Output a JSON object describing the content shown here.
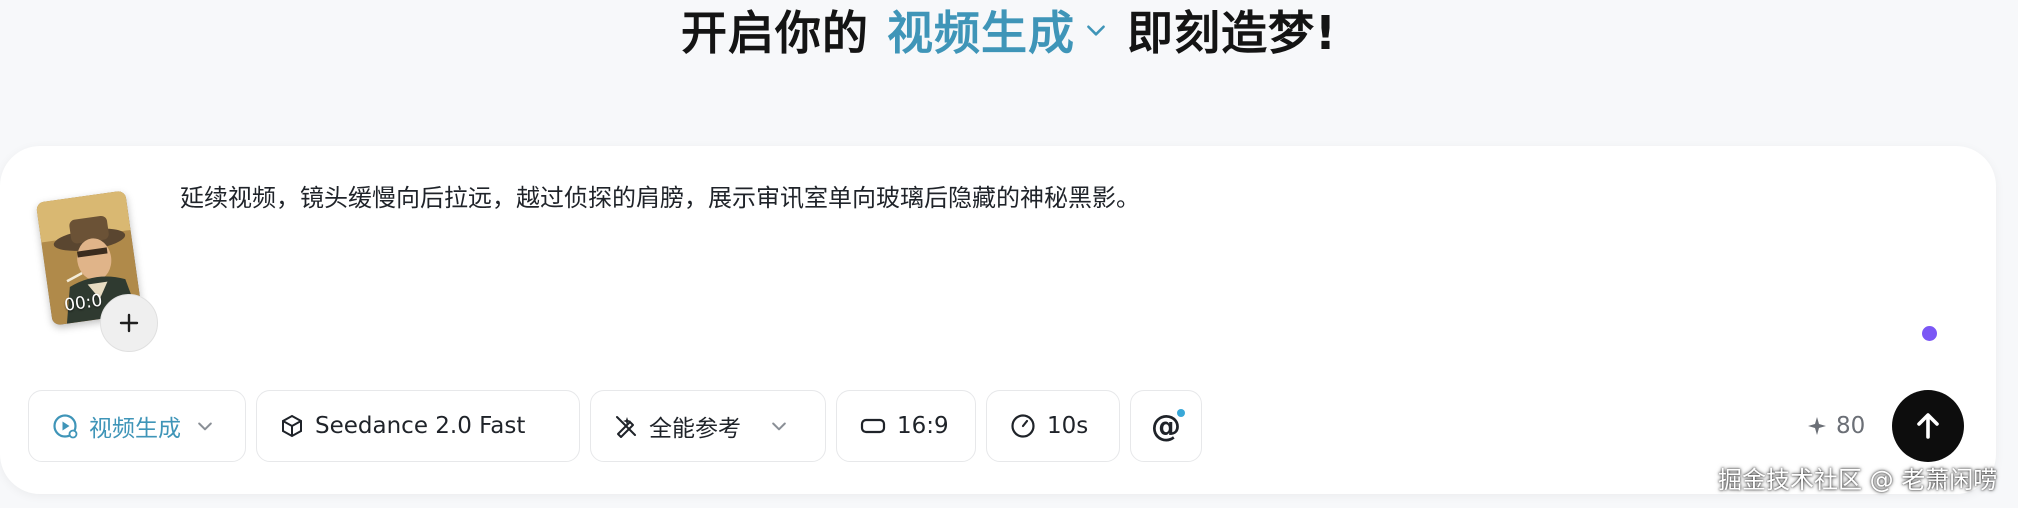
{
  "header": {
    "prefix": "开启你的",
    "mode": "视频生成",
    "suffix": "即刻造梦!"
  },
  "prompt": {
    "text": "延续视频，镜头缓慢向后拉远，越过侦探的肩膀，展示审讯室单向玻璃后隐藏的神秘黑影。",
    "attachment_duration": "00:0"
  },
  "toolbar": {
    "mode_label": "视频生成",
    "model_label": "Seedance 2.0 Fast",
    "reference_label": "全能参考",
    "ratio_label": "16:9",
    "duration_label": "10s",
    "mention_label": "@"
  },
  "credits": {
    "value": "80"
  },
  "watermark": "掘金技术社区 @ 老萧闲唠",
  "colors": {
    "accent": "#3f95b8",
    "status_dot": "#7b57f5",
    "send_button": "#0d0d0d"
  },
  "icons": {
    "mode": "video-play-icon",
    "model": "cube-icon",
    "reference": "magic-pen-icon",
    "ratio": "aspect-ratio-icon",
    "duration": "clock-icon",
    "credits": "sparkle-icon",
    "send": "arrow-up-icon",
    "add": "plus-icon"
  }
}
